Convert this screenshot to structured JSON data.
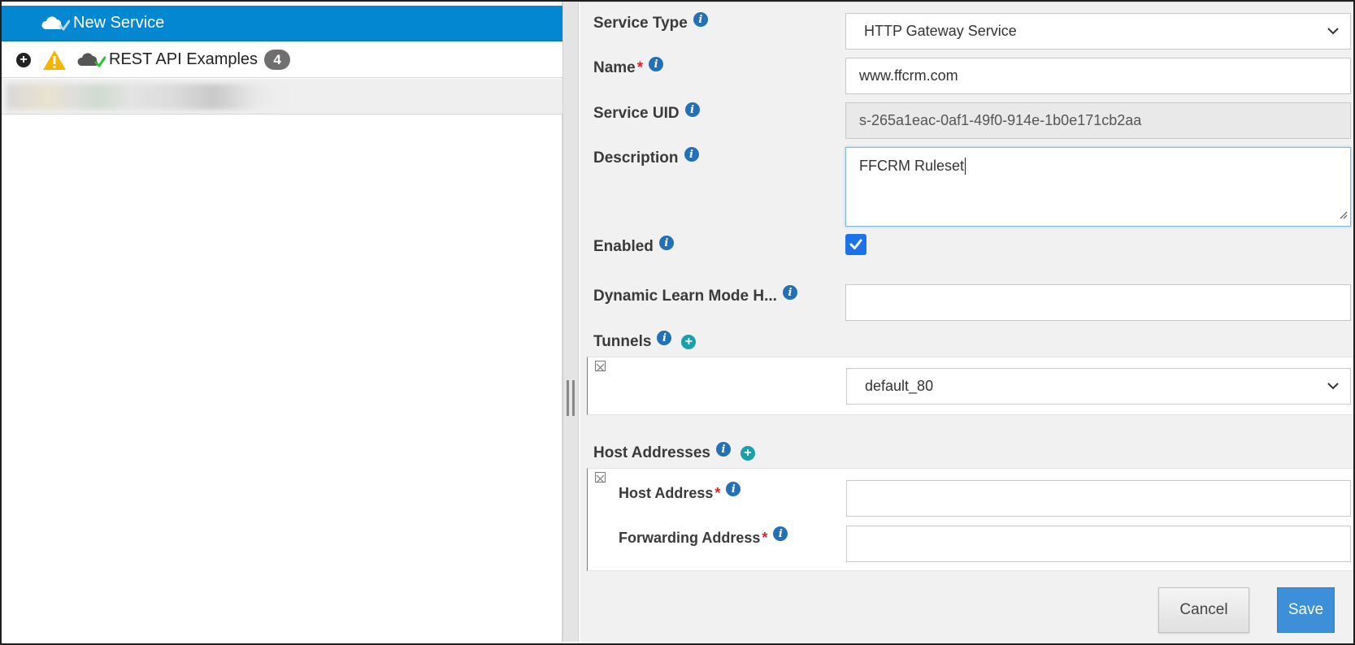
{
  "tree": {
    "selected": {
      "label": "New Service"
    },
    "rest": {
      "label": "REST API Examples",
      "badge": "4"
    }
  },
  "form": {
    "service_type": {
      "label": "Service Type",
      "value": "HTTP Gateway Service"
    },
    "name": {
      "label": "Name",
      "required_mark": "*",
      "value": "www.ffcrm.com"
    },
    "service_uid": {
      "label": "Service UID",
      "value": "s-265a1eac-0af1-49f0-914e-1b0e171cb2aa"
    },
    "description": {
      "label": "Description",
      "value": "FFCRM Ruleset"
    },
    "enabled": {
      "label": "Enabled",
      "checked": true
    },
    "dynamic_learn": {
      "label": "Dynamic Learn Mode H...",
      "value": ""
    },
    "tunnels": {
      "label": "Tunnels",
      "selected": "default_80"
    },
    "host_addresses": {
      "label": "Host Addresses",
      "host_address": {
        "label": "Host Address",
        "required_mark": "*",
        "value": ""
      },
      "forwarding_address": {
        "label": "Forwarding Address",
        "required_mark": "*",
        "value": ""
      }
    }
  },
  "buttons": {
    "cancel": "Cancel",
    "save": "Save"
  },
  "icons": {
    "info": "info-icon",
    "add": "add-circle-icon",
    "remove": "remove-square-icon",
    "expand": "expand-plus-icon",
    "warning": "warning-icon",
    "cloud": "cloud-check-icon",
    "dropdown": "chevron-down-icon"
  },
  "colors": {
    "selected_row": "#0387d1",
    "info": "#2470b8",
    "add": "#1aa0a8",
    "required": "#d9242c",
    "save_button": "#3d8fd7",
    "checkbox": "#1a73e8",
    "warning": "#f4b400",
    "check": "#2fbf2f"
  }
}
